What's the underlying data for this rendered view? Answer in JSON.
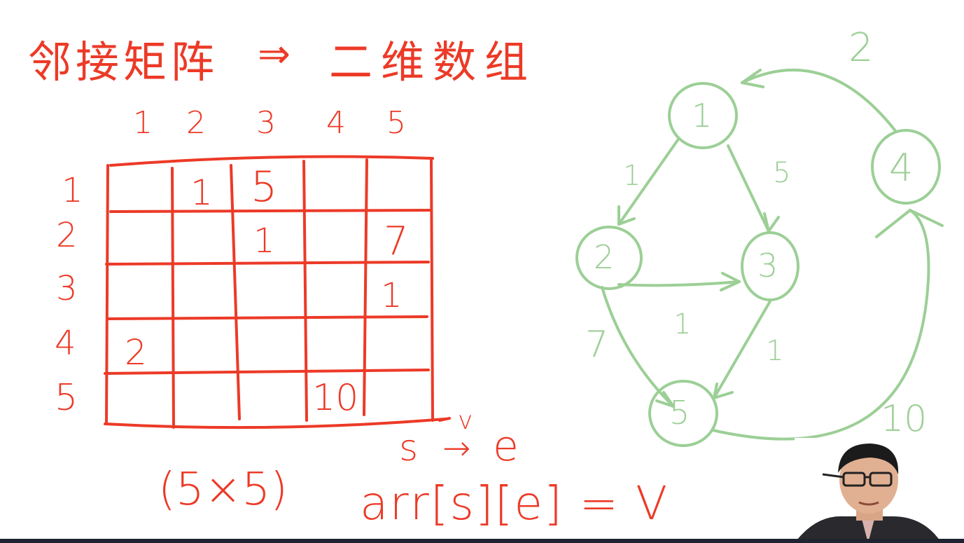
{
  "heading": {
    "left": "邻接矩阵",
    "arrow": "⇒",
    "right": "二维数组"
  },
  "matrix": {
    "col_headers": [
      "1",
      "2",
      "3",
      "4",
      "5"
    ],
    "row_headers": [
      "1",
      "2",
      "3",
      "4",
      "5"
    ],
    "cells": [
      {
        "r": 1,
        "c": 2,
        "v": "1"
      },
      {
        "r": 1,
        "c": 3,
        "v": "5"
      },
      {
        "r": 2,
        "c": 3,
        "v": "1"
      },
      {
        "r": 2,
        "c": 5,
        "v": "7"
      },
      {
        "r": 3,
        "c": 5,
        "v": "1"
      },
      {
        "r": 4,
        "c": 1,
        "v": "2"
      },
      {
        "r": 5,
        "c": 4,
        "v": "10"
      }
    ],
    "corner_mark": "v",
    "size_note": "(5×5)"
  },
  "notation": {
    "s": "s",
    "arrow": "→",
    "e": "e",
    "formula": "arr[s][e] = V"
  },
  "graph": {
    "nodes": [
      "1",
      "2",
      "3",
      "4",
      "5"
    ],
    "edges": [
      {
        "from": "1",
        "to": "2",
        "weight": "1"
      },
      {
        "from": "1",
        "to": "3",
        "weight": "5"
      },
      {
        "from": "2",
        "to": "3",
        "weight": "1"
      },
      {
        "from": "2",
        "to": "5",
        "weight": "7"
      },
      {
        "from": "3",
        "to": "5",
        "weight": "1"
      },
      {
        "from": "4",
        "to": "1",
        "weight": "2"
      },
      {
        "from": "5",
        "to": "4",
        "weight": "10"
      }
    ]
  },
  "colors": {
    "ink_red": "#ec3a27",
    "ink_green": "#9ccf96"
  }
}
